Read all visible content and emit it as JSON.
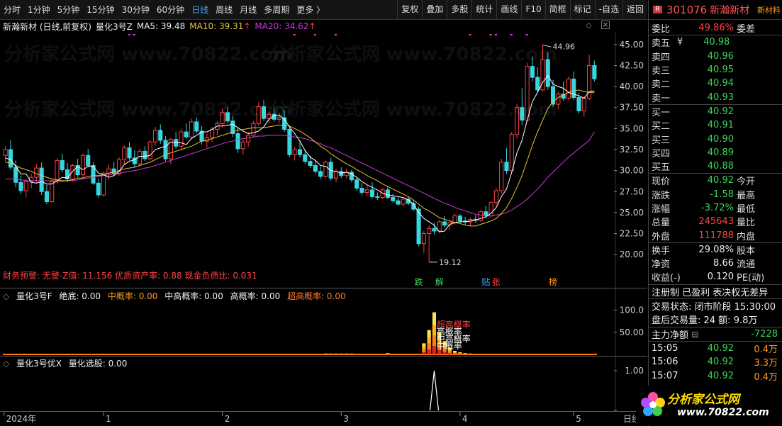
{
  "toolbar": {
    "periods": [
      "分时",
      "1分钟",
      "5分钟",
      "15分钟",
      "30分钟",
      "60分钟",
      "日线",
      "周线",
      "月线",
      "多周期",
      "更多 〉"
    ],
    "active": "日线",
    "tools": [
      "复权",
      "叠加",
      "多股",
      "统计",
      "画线",
      "F10",
      "简框",
      "标记",
      "-自选",
      "返回"
    ]
  },
  "main": {
    "stock_label": "新瀚新材 (日线,前复权)",
    "indicator_name": "量化3号Z",
    "ma5": "MA5: 39.48",
    "ma10": "MA10: 39.31",
    "ma20": "MA20: 34.62",
    "up_arrow": "↑",
    "price_ticks": [
      "45.00",
      "42.50",
      "40.00",
      "37.50",
      "35.00",
      "32.50",
      "30.00",
      "27.50",
      "25.00",
      "22.50",
      "20.00"
    ],
    "high_label": "44.96",
    "low_label": "19.12",
    "warning": "财务预警: 无警-Z值: 11.156 优质资产率: 0.88 现金负债比: 0.031",
    "markers": [
      "跌",
      "解",
      "贴",
      "张",
      "榜"
    ],
    "watermark": "分析家公式网 www.70822.com"
  },
  "sub1": {
    "name": "量化3号F",
    "items": [
      "绝底: 0.00",
      "中概率: 0.00",
      "中高概率: 0.00",
      "高概率: 0.00",
      "超高概率: 0.00"
    ],
    "ticks": [
      "100.0",
      "50.00"
    ],
    "overlay": [
      "超高概率",
      "高概率",
      "中高概率",
      "中概率"
    ]
  },
  "sub2": {
    "name": "量化3号优X",
    "items": [
      "量化选股: 0.00"
    ],
    "ticks": [
      "1.00",
      "0"
    ]
  },
  "xaxis": [
    "2024年",
    "1",
    "2",
    "3",
    "4",
    "5",
    "日线"
  ],
  "quote": {
    "flag": "R",
    "code": "301076",
    "name": "新瀚新材",
    "corner": "新材料",
    "weibi": {
      "l": "委比",
      "v": "49.86%",
      "r": "委差"
    },
    "asks": [
      {
        "l": "卖五",
        "m": "¥",
        "v": "40.98"
      },
      {
        "l": "卖四",
        "v": "40.96"
      },
      {
        "l": "卖三",
        "v": "40.95"
      },
      {
        "l": "卖二",
        "v": "40.94"
      },
      {
        "l": "卖一",
        "v": "40.93"
      }
    ],
    "bids": [
      {
        "l": "买一",
        "v": "40.92"
      },
      {
        "l": "买二",
        "v": "40.91"
      },
      {
        "l": "买三",
        "v": "40.90"
      },
      {
        "l": "买四",
        "v": "40.89"
      },
      {
        "l": "买五",
        "v": "40.88"
      }
    ],
    "stats": [
      {
        "l": "现价",
        "v": "40.92",
        "r": "今开",
        "c": "green"
      },
      {
        "l": "涨跌",
        "v": "-1.58",
        "r": "最高",
        "c": "green"
      },
      {
        "l": "涨幅",
        "v": "-3.72%",
        "r": "最低",
        "c": "green"
      },
      {
        "l": "总量",
        "v": "245643",
        "r": "量比",
        "c": "red"
      },
      {
        "l": "外盘",
        "v": "111788",
        "r": "内盘",
        "c": "red"
      }
    ],
    "stats2": [
      {
        "l": "换手",
        "v": "29.08%",
        "r": "股本"
      },
      {
        "l": "净资",
        "v": "8.66",
        "r": "流通"
      },
      {
        "l": "收益(-)",
        "v": "0.120",
        "r": "PE(动)"
      }
    ],
    "tags": "注册制 已盈利 表决权无差异",
    "status": "交易状态: 闭市阶段 15:30:00",
    "after": "盘后交易量: 24  额: 9.8万",
    "netflow": {
      "l": "主力净额",
      "v": "-7228"
    },
    "ticks": [
      {
        "t": "15:05",
        "p": "40.92",
        "a": "0.4万"
      },
      {
        "t": "15:06",
        "p": "40.92",
        "a": "3.3万"
      },
      {
        "t": "15:07",
        "p": "40.92",
        "a": "0.4万"
      }
    ],
    "logo_text": "分析家公式网",
    "logo_url": "www.70822.com"
  },
  "colors": {
    "up": "#ff4040",
    "down": "#36d6e0",
    "ma5": "#ffffff",
    "ma10": "#e6c33c",
    "ma20": "#c73ad6"
  },
  "chart_data": {
    "type": "candlestick",
    "ylim": [
      19,
      46
    ],
    "dates_axis": [
      "2024年",
      "1",
      "2",
      "3",
      "4",
      "5"
    ],
    "ohlc": [
      [
        31.8,
        32.9,
        31.0,
        32.5
      ],
      [
        32.5,
        33.6,
        30.1,
        30.4
      ],
      [
        30.4,
        31.2,
        28.0,
        28.6
      ],
      [
        28.6,
        29.4,
        27.2,
        27.6
      ],
      [
        27.6,
        29.0,
        26.8,
        28.7
      ],
      [
        28.7,
        29.6,
        27.9,
        29.2
      ],
      [
        29.2,
        30.8,
        28.5,
        30.3
      ],
      [
        30.3,
        31.0,
        27.1,
        27.5
      ],
      [
        27.5,
        28.3,
        26.0,
        26.3
      ],
      [
        26.3,
        28.9,
        26.1,
        28.8
      ],
      [
        28.8,
        31.5,
        28.4,
        31.2
      ],
      [
        31.2,
        32.0,
        29.8,
        30.1
      ],
      [
        30.1,
        30.9,
        28.6,
        29.0
      ],
      [
        29.0,
        30.8,
        28.7,
        30.6
      ],
      [
        30.6,
        31.4,
        29.2,
        29.5
      ],
      [
        29.5,
        32.0,
        29.1,
        31.8
      ],
      [
        31.8,
        32.6,
        30.4,
        30.6
      ],
      [
        30.6,
        31.0,
        28.3,
        28.5
      ],
      [
        28.5,
        29.0,
        26.8,
        27.1
      ],
      [
        27.1,
        29.9,
        26.9,
        29.7
      ],
      [
        29.7,
        30.7,
        28.9,
        30.2
      ],
      [
        30.2,
        31.0,
        29.3,
        29.6
      ],
      [
        29.6,
        31.6,
        29.4,
        31.3
      ],
      [
        31.3,
        33.0,
        30.8,
        32.7
      ],
      [
        32.7,
        33.4,
        31.2,
        31.5
      ],
      [
        31.5,
        32.4,
        30.4,
        30.8
      ],
      [
        30.8,
        32.6,
        30.5,
        32.3
      ],
      [
        32.3,
        32.9,
        31.1,
        31.4
      ],
      [
        31.4,
        33.6,
        31.2,
        33.4
      ],
      [
        33.4,
        35.2,
        33.0,
        34.8
      ],
      [
        34.8,
        35.5,
        33.2,
        33.6
      ],
      [
        33.6,
        34.1,
        31.1,
        31.4
      ],
      [
        31.4,
        33.9,
        30.8,
        33.7
      ],
      [
        33.7,
        34.6,
        32.6,
        32.9
      ],
      [
        32.9,
        35.0,
        32.5,
        34.6
      ],
      [
        34.6,
        35.6,
        33.8,
        34.0
      ],
      [
        34.0,
        36.2,
        33.7,
        35.8
      ],
      [
        35.8,
        36.3,
        34.4,
        34.7
      ],
      [
        34.7,
        35.3,
        33.1,
        33.5
      ],
      [
        33.5,
        34.4,
        32.7,
        33.9
      ],
      [
        33.9,
        35.2,
        33.4,
        34.9
      ],
      [
        34.9,
        35.9,
        34.2,
        35.6
      ],
      [
        35.6,
        37.4,
        35.1,
        36.9
      ],
      [
        36.9,
        37.6,
        35.6,
        35.9
      ],
      [
        35.9,
        36.5,
        34.0,
        34.4
      ],
      [
        34.4,
        35.1,
        32.1,
        32.6
      ],
      [
        32.6,
        33.7,
        31.9,
        33.4
      ],
      [
        33.4,
        34.6,
        32.8,
        34.2
      ],
      [
        34.2,
        35.9,
        33.9,
        35.6
      ],
      [
        35.6,
        38.1,
        35.3,
        37.6
      ],
      [
        37.6,
        38.4,
        35.9,
        36.2
      ],
      [
        36.2,
        37.0,
        35.6,
        36.7
      ],
      [
        36.7,
        37.4,
        35.8,
        36.1
      ],
      [
        36.1,
        36.9,
        35.6,
        36.3
      ],
      [
        36.3,
        37.2,
        34.6,
        34.9
      ],
      [
        34.9,
        35.3,
        31.6,
        31.9
      ],
      [
        31.9,
        32.8,
        31.2,
        32.5
      ],
      [
        32.5,
        33.6,
        31.6,
        31.9
      ],
      [
        31.9,
        32.4,
        30.8,
        31.1
      ],
      [
        31.1,
        31.8,
        30.3,
        30.6
      ],
      [
        30.6,
        31.2,
        29.6,
        29.9
      ],
      [
        29.9,
        30.5,
        29.0,
        29.3
      ],
      [
        29.3,
        31.2,
        29.1,
        31.0
      ],
      [
        31.0,
        31.5,
        28.8,
        29.1
      ],
      [
        29.1,
        30.2,
        28.6,
        29.9
      ],
      [
        29.9,
        30.4,
        29.1,
        29.4
      ],
      [
        29.4,
        30.2,
        29.1,
        29.8
      ],
      [
        29.8,
        30.1,
        28.6,
        28.9
      ],
      [
        28.9,
        29.2,
        27.6,
        27.9
      ],
      [
        27.9,
        28.5,
        27.1,
        27.4
      ],
      [
        27.4,
        28.2,
        27.0,
        27.7
      ],
      [
        27.7,
        28.6,
        26.7,
        26.9
      ],
      [
        26.9,
        27.4,
        26.5,
        26.8
      ],
      [
        26.8,
        27.9,
        26.6,
        27.7
      ],
      [
        27.7,
        28.1,
        26.6,
        26.8
      ],
      [
        26.8,
        27.2,
        26.2,
        26.4
      ],
      [
        26.4,
        26.8,
        25.8,
        26.0
      ],
      [
        26.0,
        26.8,
        25.7,
        26.6
      ],
      [
        26.6,
        26.9,
        25.9,
        26.1
      ],
      [
        26.1,
        26.5,
        25.2,
        25.4
      ],
      [
        25.4,
        25.7,
        21.0,
        21.3
      ],
      [
        21.3,
        22.8,
        20.2,
        22.5
      ],
      [
        22.5,
        23.5,
        19.1,
        23.1
      ],
      [
        23.1,
        23.8,
        22.4,
        22.8
      ],
      [
        22.8,
        24.1,
        22.6,
        23.9
      ],
      [
        23.9,
        24.6,
        23.2,
        23.5
      ],
      [
        23.5,
        24.1,
        22.9,
        23.8
      ],
      [
        23.8,
        24.9,
        23.6,
        24.6
      ],
      [
        24.6,
        24.8,
        23.8,
        24.0
      ],
      [
        24.0,
        24.5,
        23.5,
        23.9
      ],
      [
        23.9,
        24.4,
        23.4,
        24.2
      ],
      [
        24.2,
        24.7,
        23.8,
        24.1
      ],
      [
        24.1,
        25.3,
        23.9,
        25.1
      ],
      [
        25.1,
        25.8,
        24.3,
        24.6
      ],
      [
        24.6,
        26.4,
        24.4,
        26.2
      ],
      [
        26.2,
        27.9,
        25.9,
        27.6
      ],
      [
        27.6,
        31.4,
        27.2,
        31.0
      ],
      [
        31.0,
        32.7,
        29.6,
        30.0
      ],
      [
        30.0,
        34.6,
        29.8,
        34.3
      ],
      [
        34.3,
        37.9,
        33.8,
        37.5
      ],
      [
        37.5,
        39.8,
        35.4,
        36.0
      ],
      [
        36.0,
        42.8,
        35.8,
        42.4
      ],
      [
        42.4,
        43.6,
        40.6,
        41.1
      ],
      [
        41.1,
        42.3,
        39.2,
        39.6
      ],
      [
        39.6,
        44.96,
        39.4,
        43.2
      ],
      [
        43.2,
        44.1,
        39.6,
        40.0
      ],
      [
        40.0,
        40.8,
        37.6,
        37.9
      ],
      [
        37.9,
        39.4,
        37.3,
        39.1
      ],
      [
        39.1,
        40.6,
        38.3,
        38.6
      ],
      [
        38.6,
        41.2,
        38.4,
        40.9
      ],
      [
        40.9,
        41.8,
        38.4,
        38.7
      ],
      [
        38.7,
        39.3,
        36.8,
        37.1
      ],
      [
        37.1,
        38.9,
        36.4,
        38.6
      ],
      [
        38.6,
        43.8,
        38.4,
        42.5
      ],
      [
        42.5,
        43.1,
        40.6,
        40.92
      ]
    ],
    "ma5": [
      31.5,
      31.3,
      30.5,
      29.6,
      29.6,
      28.6,
      28.5,
      28.7,
      28.4,
      28.4,
      28.8,
      29.2,
      29.1,
      29.9,
      30.5,
      30.1,
      30.5,
      30.5,
      29.7,
      29.5,
      29.2,
      29.4,
      29.9,
      30.7,
      31.1,
      31.3,
      31.7,
      31.7,
      31.8,
      32.5,
      32.7,
      32.9,
      33.4,
      33.3,
      33.3,
      33.1,
      33.8,
      34.2,
      34.6,
      34.6,
      34.9,
      35.3,
      35.3,
      35.4,
      35.5,
      35.1,
      34.7,
      34.4,
      34.5,
      34.7,
      35.2,
      36.1,
      36.5,
      36.6,
      36.1,
      35.2,
      34.4,
      33.5,
      32.4,
      31.6,
      31.2,
      30.6,
      30.5,
      30.0,
      29.9,
      29.7,
      29.8,
      29.6,
      29.2,
      28.7,
      28.3,
      28.0,
      27.7,
      27.3,
      27.1,
      27.0,
      26.9,
      26.8,
      26.5,
      26.0,
      25.0,
      24.3,
      23.9,
      23.5,
      22.7,
      22.8,
      23.6,
      23.8,
      23.9,
      23.9,
      24.0,
      24.1,
      24.3,
      24.5,
      24.9,
      25.6,
      26.9,
      27.8,
      29.8,
      32.1,
      33.6,
      36.0,
      38.2,
      39.3,
      40.5,
      41.3,
      40.3,
      40.0,
      39.8,
      39.3,
      39.1,
      38.9,
      38.6,
      39.4,
      39.48
    ],
    "ma10": [
      31.0,
      30.9,
      30.6,
      30.3,
      30.1,
      29.9,
      29.6,
      29.4,
      29.2,
      29.0,
      28.9,
      28.8,
      28.8,
      28.9,
      29.1,
      29.1,
      29.3,
      29.4,
      29.4,
      29.5,
      29.7,
      29.8,
      30.0,
      30.2,
      30.3,
      30.4,
      30.6,
      30.8,
      31.0,
      31.3,
      31.6,
      31.9,
      32.1,
      32.3,
      32.5,
      32.7,
      32.9,
      33.2,
      33.5,
      33.6,
      33.8,
      34.0,
      34.2,
      34.4,
      34.6,
      34.8,
      34.9,
      35.0,
      35.1,
      35.1,
      35.1,
      35.2,
      35.3,
      35.4,
      35.4,
      35.3,
      35.0,
      34.7,
      34.3,
      33.9,
      33.4,
      32.9,
      32.5,
      32.0,
      31.6,
      31.2,
      30.8,
      30.5,
      30.1,
      29.8,
      29.4,
      29.1,
      28.8,
      28.4,
      28.1,
      27.8,
      27.5,
      27.2,
      26.9,
      26.5,
      26.0,
      25.5,
      25.2,
      24.8,
      24.4,
      24.2,
      24.0,
      23.8,
      23.7,
      23.5,
      23.4,
      23.4,
      23.6,
      23.8,
      24.0,
      24.3,
      24.9,
      25.6,
      26.7,
      28.0,
      29.4,
      31.2,
      33.0,
      34.6,
      36.0,
      37.4,
      38.2,
      38.7,
      39.0,
      39.3,
      39.5,
      39.6,
      39.4,
      39.3,
      39.31
    ],
    "ma20": [
      29.0,
      29.0,
      29.0,
      28.9,
      28.8,
      28.8,
      28.8,
      28.8,
      28.8,
      28.7,
      28.7,
      28.7,
      28.8,
      28.8,
      28.9,
      29.0,
      29.1,
      29.2,
      29.3,
      29.4,
      29.5,
      29.6,
      29.7,
      29.8,
      29.9,
      30.0,
      30.1,
      30.3,
      30.4,
      30.6,
      30.8,
      31.0,
      31.2,
      31.4,
      31.6,
      31.8,
      32.0,
      32.2,
      32.4,
      32.6,
      32.8,
      33.0,
      33.2,
      33.4,
      33.5,
      33.7,
      33.8,
      33.9,
      34.0,
      34.1,
      34.1,
      34.2,
      34.2,
      34.2,
      34.2,
      34.1,
      34.0,
      33.9,
      33.8,
      33.6,
      33.4,
      33.2,
      32.9,
      32.7,
      32.4,
      32.1,
      31.8,
      31.5,
      31.2,
      30.9,
      30.6,
      30.3,
      30.0,
      29.7,
      29.4,
      29.1,
      28.8,
      28.5,
      28.2,
      27.9,
      27.6,
      27.3,
      27.0,
      26.7,
      26.4,
      26.1,
      25.9,
      25.6,
      25.4,
      25.2,
      25.0,
      24.8,
      24.7,
      24.6,
      24.6,
      24.7,
      24.8,
      25.0,
      25.3,
      25.7,
      26.1,
      26.6,
      27.2,
      27.8,
      28.5,
      29.2,
      29.8,
      30.4,
      31.0,
      31.6,
      32.1,
      32.6,
      33.1,
      33.6,
      34.62
    ],
    "sub1_ylim": [
      0,
      120
    ],
    "sub1_values": [
      {
        "i": 81,
        "v": 25
      },
      {
        "i": 82,
        "v": 55
      },
      {
        "i": 83,
        "v": 95
      },
      {
        "i": 84,
        "v": 50
      },
      {
        "i": 85,
        "v": 30
      },
      {
        "i": 86,
        "v": 15
      },
      {
        "i": 87,
        "v": 8
      },
      {
        "i": 88,
        "v": 5
      },
      {
        "i": 89,
        "v": 3
      },
      {
        "i": 90,
        "v": 2
      },
      {
        "i": 74,
        "v": 3
      },
      {
        "i": 62,
        "v": 2
      },
      {
        "i": 63,
        "v": 2
      },
      {
        "i": 64,
        "v": 2
      },
      {
        "i": 65,
        "v": 2
      },
      {
        "i": 66,
        "v": 2
      },
      {
        "i": 67,
        "v": 2
      }
    ],
    "sub2_spike": {
      "i": 83,
      "v": 1.0
    }
  }
}
